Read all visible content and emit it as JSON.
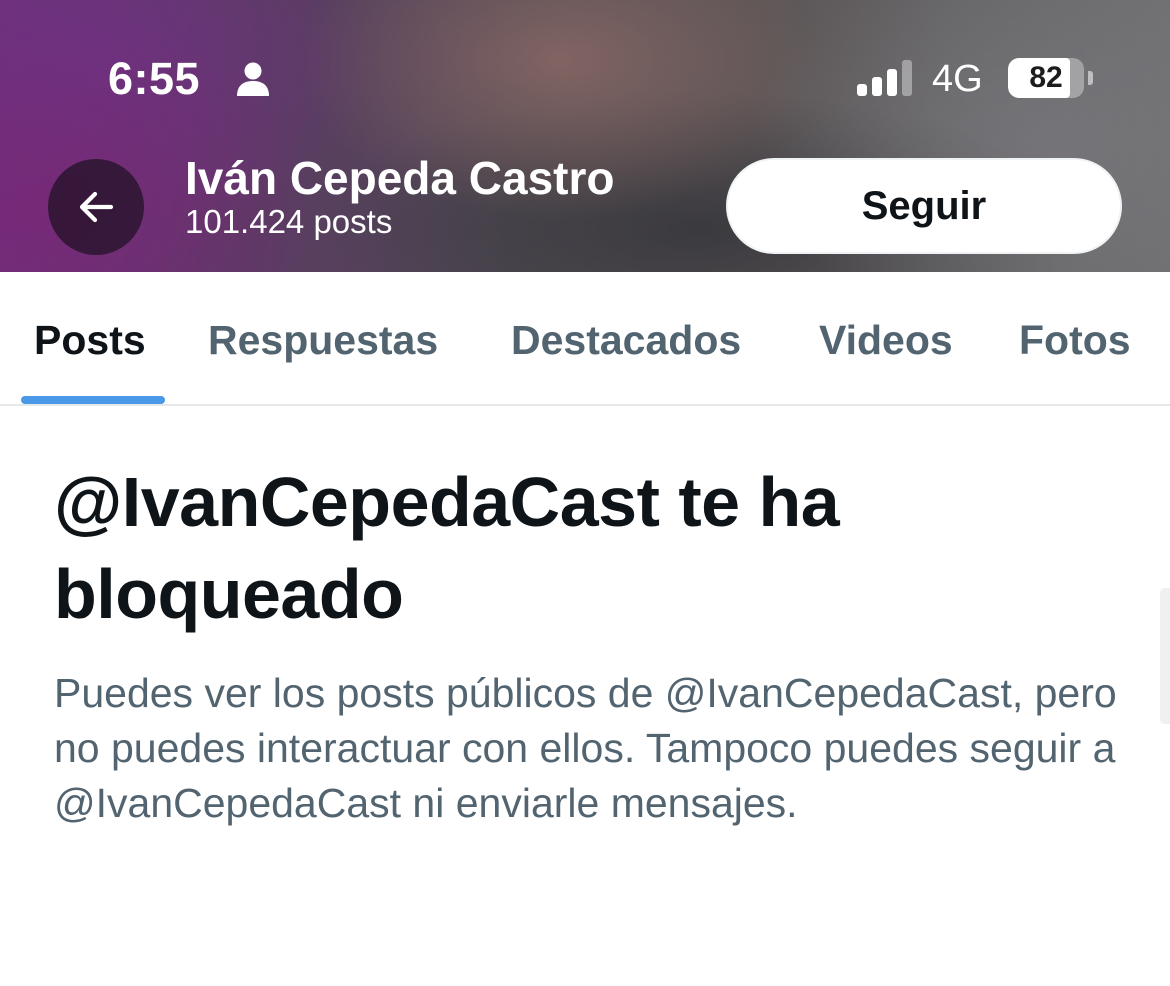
{
  "status_bar": {
    "time": "6:55",
    "network": "4G",
    "battery_level": "82",
    "battery_fraction": 0.82,
    "signal_bars_active": 3,
    "signal_bars_total": 4
  },
  "profile_header": {
    "name": "Iván Cepeda Castro",
    "post_count": "101.424 posts",
    "follow_label": "Seguir",
    "back_icon": "arrow-left-icon"
  },
  "tabs": [
    {
      "label": "Posts",
      "active": true
    },
    {
      "label": "Respuestas",
      "active": false
    },
    {
      "label": "Destacados",
      "active": false
    },
    {
      "label": "Videos",
      "active": false
    },
    {
      "label": "Fotos",
      "active": false
    }
  ],
  "blocked": {
    "title": "@IvanCepedaCast te ha bloqueado",
    "description": "Puedes ver los posts públicos de @IvanCepedaCast, pero no puedes interactuar con ellos. Tampoco puedes seguir a @IvanCepedaCast ni enviarle mensajes."
  },
  "colors": {
    "accent": "#4a99e9",
    "text_primary": "#0f1419",
    "text_secondary": "#536471"
  }
}
